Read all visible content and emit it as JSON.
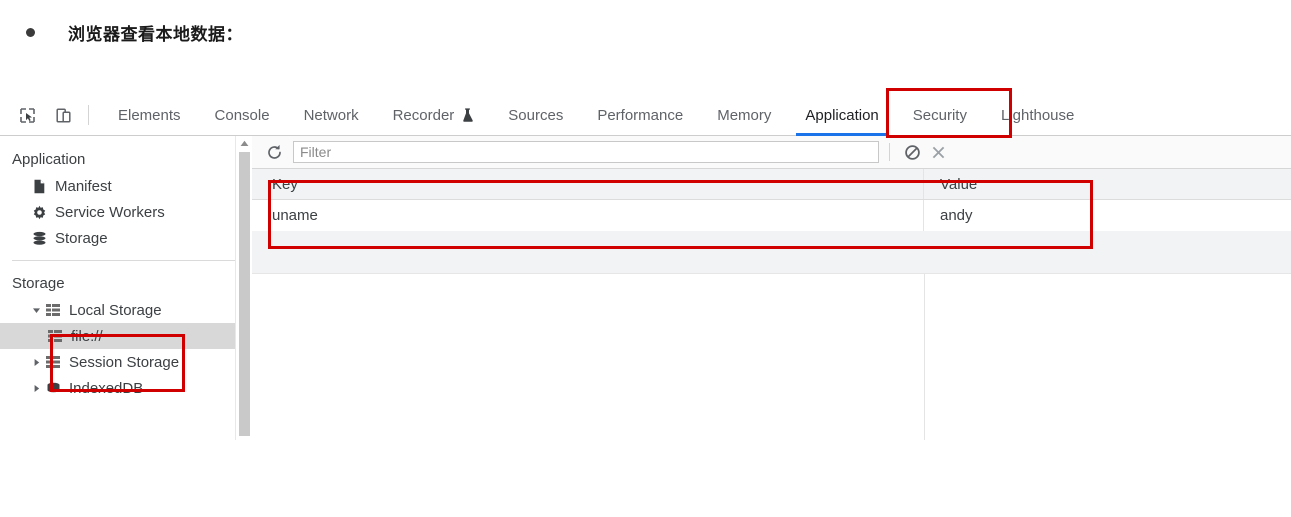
{
  "document": {
    "bullet_heading": "浏览器查看本地数据："
  },
  "devtools": {
    "toolbar_icons": [
      {
        "name": "inspect-element-icon",
        "label": "Inspect element"
      },
      {
        "name": "device-toolbar-icon",
        "label": "Toggle device toolbar"
      }
    ],
    "tabs": [
      {
        "label": "Elements",
        "active": false,
        "icon": ""
      },
      {
        "label": "Console",
        "active": false,
        "icon": ""
      },
      {
        "label": "Network",
        "active": false,
        "icon": ""
      },
      {
        "label": "Recorder",
        "active": false,
        "icon": "flask-icon"
      },
      {
        "label": "Sources",
        "active": false,
        "icon": ""
      },
      {
        "label": "Performance",
        "active": false,
        "icon": ""
      },
      {
        "label": "Memory",
        "active": false,
        "icon": ""
      },
      {
        "label": "Application",
        "active": true,
        "icon": ""
      },
      {
        "label": "Security",
        "active": false,
        "icon": ""
      },
      {
        "label": "Lighthouse",
        "active": false,
        "icon": ""
      }
    ],
    "active_tab": "Application",
    "active_tab_underline_color": "#1a73e8"
  },
  "sidebar": {
    "sections": [
      {
        "title": "Application",
        "items": [
          {
            "label": "Manifest",
            "icon": "document-icon",
            "level": 1,
            "selected": false,
            "twisty": ""
          },
          {
            "label": "Service Workers",
            "icon": "gear-icon",
            "level": 1,
            "selected": false,
            "twisty": ""
          },
          {
            "label": "Storage",
            "icon": "database-stack-icon",
            "level": 1,
            "selected": false,
            "twisty": ""
          }
        ]
      },
      {
        "title": "Storage",
        "items": [
          {
            "label": "Local Storage",
            "icon": "storage-grid-icon",
            "level": 1,
            "selected": false,
            "twisty": "expanded"
          },
          {
            "label": "file://",
            "icon": "storage-grid-icon",
            "level": 2,
            "selected": true,
            "twisty": ""
          },
          {
            "label": "Session Storage",
            "icon": "storage-grid-icon",
            "level": 1,
            "selected": false,
            "twisty": "collapsed"
          },
          {
            "label": "IndexedDB",
            "icon": "database-icon",
            "level": 1,
            "selected": false,
            "twisty": "collapsed"
          }
        ]
      }
    ]
  },
  "storage_panel": {
    "toolbar": {
      "refresh_label": "Refresh",
      "filter_placeholder": "Filter",
      "filter_value": "",
      "clear_all_label": "Clear All",
      "delete_selected_label": "Delete Selected"
    },
    "table": {
      "columns": [
        "Key",
        "Value"
      ],
      "rows": [
        {
          "key": "uname",
          "value": "andy"
        }
      ]
    }
  },
  "annotations": {
    "color": "#d00000",
    "boxes": [
      {
        "name": "application-tab-highlight",
        "target": "Application"
      },
      {
        "name": "storage-table-highlight",
        "target": "Key / Value table"
      },
      {
        "name": "local-storage-highlight",
        "target": "Local Storage / file://"
      }
    ]
  }
}
